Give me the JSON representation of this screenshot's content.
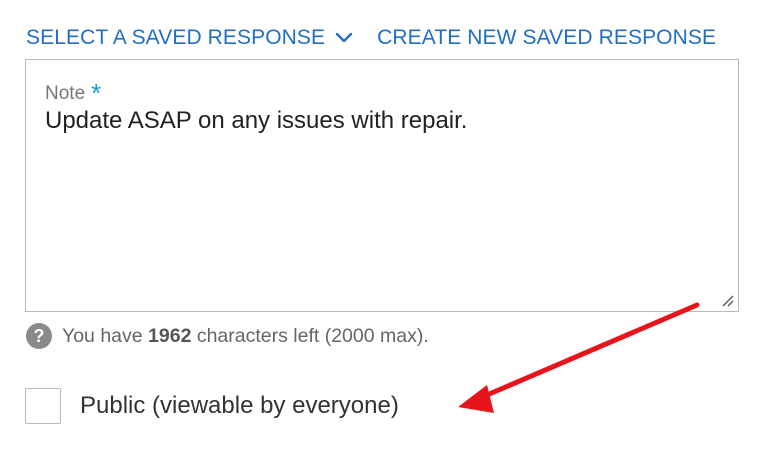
{
  "links": {
    "select_saved": "SELECT A SAVED RESPONSE",
    "create_saved": "CREATE NEW SAVED RESPONSE"
  },
  "note": {
    "label": "Note",
    "required_marker": "*",
    "value": "Update ASAP on any issues with repair."
  },
  "help": {
    "prefix": "You have ",
    "count": "1962",
    "suffix": " characters left (2000 max).",
    "icon": "?"
  },
  "public": {
    "label": "Public (viewable by everyone)",
    "checked": false
  },
  "colors": {
    "link": "#1f6fc5",
    "required": "#1a9ad6",
    "annotation_arrow": "#e8141b"
  }
}
